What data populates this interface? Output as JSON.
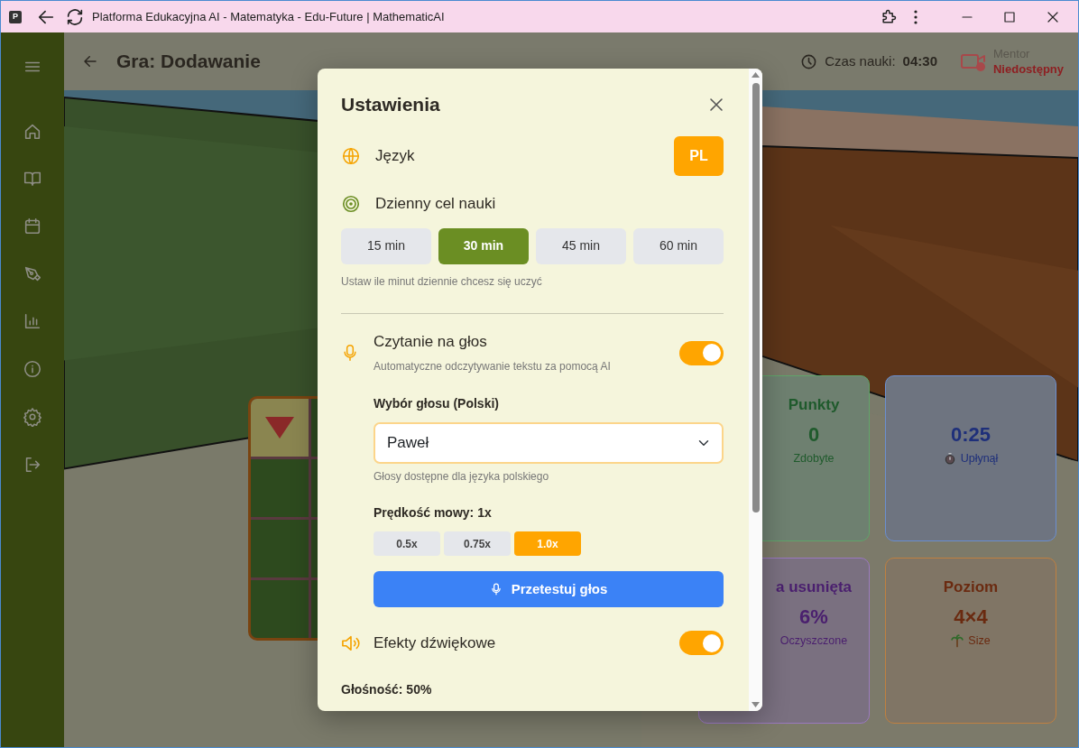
{
  "window": {
    "favicon": "P",
    "title": "Platforma Edukacyjna AI - Matematyka - Edu-Future | MathematicAI"
  },
  "header": {
    "title": "Gra: Dodawanie",
    "timer_label": "Czas nauki:",
    "timer_value": "04:30",
    "mentor_label": "Mentor",
    "mentor_status": "Niedostępny"
  },
  "board": {
    "rows": [
      [
        {
          "kind": "marker"
        },
        {
          "kind": "grass"
        }
      ],
      [
        {
          "kind": "grass"
        },
        {
          "kind": "grass"
        }
      ],
      [
        {
          "kind": "grass"
        },
        {
          "kind": "grass"
        }
      ],
      [
        {
          "kind": "grass"
        },
        {
          "kind": "grass"
        }
      ]
    ]
  },
  "stats": [
    {
      "title": "Punkty",
      "value": "0",
      "caption": "Zdobyte",
      "color": "#1f5a2c"
    },
    {
      "value": "0:25",
      "caption": "Upłynął",
      "color": "#1e2f7a"
    },
    {
      "title": "a usunięta",
      "value": "6%",
      "caption": "Oczyszczone",
      "color": "#4a1f6e"
    },
    {
      "title": "Poziom",
      "value": "4×4",
      "caption": "Size",
      "color": "#6a2a10"
    }
  ],
  "settings": {
    "title": "Ustawienia",
    "language": {
      "label": "Język",
      "value": "PL"
    },
    "daily_goal": {
      "label": "Dzienny cel nauki",
      "hint": "Ustaw ile minut dziennie chcesz się uczyć",
      "options": [
        {
          "label": "15 min",
          "selected": false
        },
        {
          "label": "30 min",
          "selected": true
        },
        {
          "label": "45 min",
          "selected": false
        },
        {
          "label": "60 min",
          "selected": false
        }
      ]
    },
    "read_aloud": {
      "label": "Czytanie na głos",
      "description": "Automatyczne odczytywanie tekstu za pomocą AI",
      "on": true,
      "voice_label": "Wybór głosu (Polski)",
      "voice": "Paweł",
      "voice_hint": "Głosy dostępne dla języka polskiego",
      "speed_label": "Prędkość mowy: 1x",
      "speeds": [
        {
          "label": "0.5x",
          "selected": false
        },
        {
          "label": "0.75x",
          "selected": false
        },
        {
          "label": "1.0x",
          "selected": true
        }
      ],
      "test_button": "Przetestuj głos"
    },
    "sound_effects": {
      "label": "Efekty dźwiękowe",
      "on": true
    },
    "volume_label": "Głośność: 50%"
  }
}
